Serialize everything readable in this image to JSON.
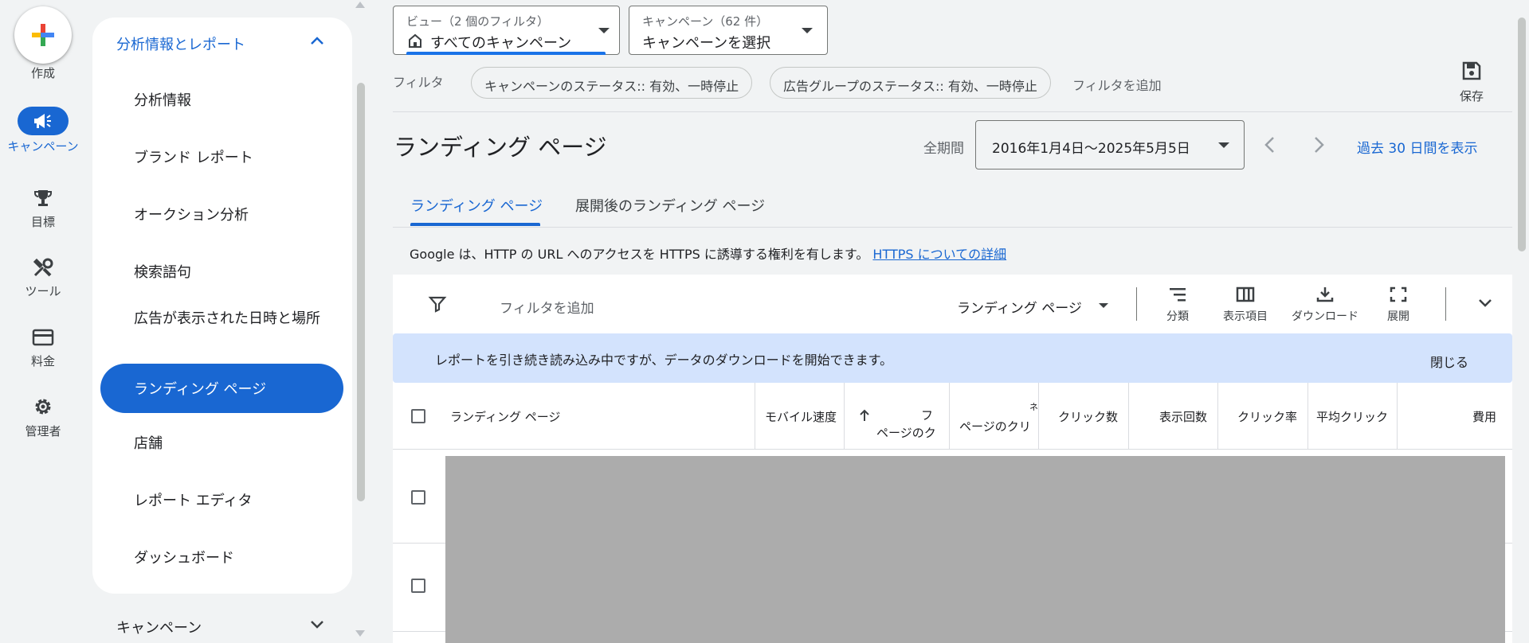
{
  "rail": {
    "create_label": "作成",
    "items": [
      {
        "label": "キャンペーン",
        "icon": "megaphone-icon",
        "active": true
      },
      {
        "label": "目標",
        "icon": "trophy-icon"
      },
      {
        "label": "ツール",
        "icon": "tools-icon"
      },
      {
        "label": "料金",
        "icon": "credit-card-icon"
      },
      {
        "label": "管理者",
        "icon": "gear-icon"
      }
    ]
  },
  "nav": {
    "section_title": "分析情報とレポート",
    "items": [
      {
        "label": "分析情報"
      },
      {
        "label": "ブランド レポート"
      },
      {
        "label": "オークション分析"
      },
      {
        "label": "検索語句"
      },
      {
        "label": "広告が表示された日時と場所"
      },
      {
        "label": "ランディング ページ",
        "active": true
      },
      {
        "label": "店舗"
      },
      {
        "label": "レポート エディタ"
      },
      {
        "label": "ダッシュボード"
      }
    ],
    "bottom_section": "キャンペーン"
  },
  "view_dropdown": {
    "label": "ビュー（2 個のフィルタ）",
    "value": "すべてのキャンペーン"
  },
  "campaign_dropdown": {
    "label": "キャンペーン（62 件）",
    "value": "キャンペーンを選択"
  },
  "filters": {
    "label": "フィルタ",
    "chips": [
      "キャンペーンのステータス:: 有効、一時停止",
      "広告グループのステータス:: 有効、一時停止"
    ],
    "add_filter": "フィルタを追加"
  },
  "save_label": "保存",
  "page": {
    "title": "ランディング ページ",
    "period_label": "全期間",
    "date_range": "2016年1月4日～2025年5月5日",
    "last30_link": "過去 30 日間を表示"
  },
  "tabs": [
    {
      "label": "ランディング ページ",
      "active": true
    },
    {
      "label": "展開後のランディング ページ"
    }
  ],
  "notice": {
    "text": "Google は、HTTP の URL へのアクセスを HTTPS に誘導する権利を有します。",
    "link": "HTTPS についての詳細"
  },
  "toolbar": {
    "add_filter": "フィルタを追加",
    "view_selector": "ランディング ページ",
    "segment": "分類",
    "columns": "表示項目",
    "download": "ダウンロード",
    "expand": "展開"
  },
  "banner": {
    "text": "レポートを引き続き読み込み中ですが、データのダウンロードを開始できます。",
    "close": "閉じる"
  },
  "table": {
    "columns": [
      "ランディング ページ",
      "モバイル速度",
      "フ",
      "ページのク",
      "ページのクリ",
      "ネ",
      "クリック数",
      "表示回数",
      "クリック率",
      "平均クリック",
      "費用"
    ]
  },
  "colors": {
    "accent": "#1967d2",
    "banner": "#d3e3fd",
    "redacted": "#acacac"
  }
}
